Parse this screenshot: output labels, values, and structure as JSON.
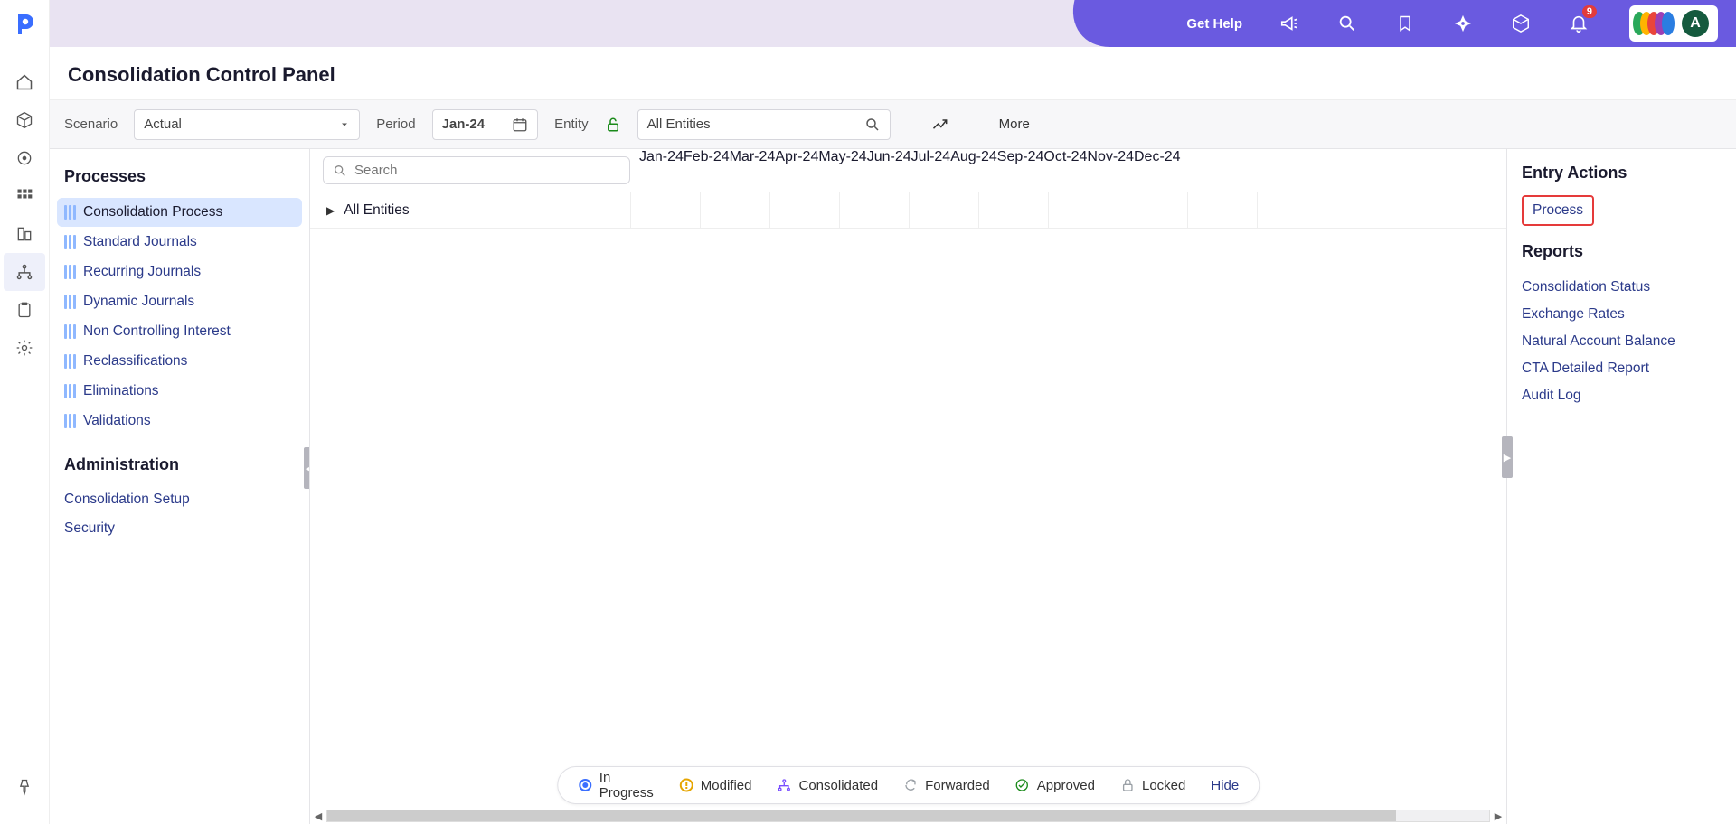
{
  "topbar": {
    "get_help": "Get Help",
    "notif_count": "9",
    "avatar_initial": "A"
  },
  "page_title": "Consolidation Control Panel",
  "filters": {
    "scenario_label": "Scenario",
    "scenario_value": "Actual",
    "period_label": "Period",
    "period_value": "Jan-24",
    "entity_label": "Entity",
    "entity_value": "All Entities",
    "more": "More"
  },
  "left": {
    "processes_header": "Processes",
    "items": [
      "Consolidation Process",
      "Standard Journals",
      "Recurring Journals",
      "Dynamic Journals",
      "Non Controlling Interest",
      "Reclassifications",
      "Eliminations",
      "Validations"
    ],
    "admin_header": "Administration",
    "admin_items": [
      "Consolidation Setup",
      "Security"
    ]
  },
  "center": {
    "search_placeholder": "Search",
    "months": [
      "Jan-24",
      "Feb-24",
      "Mar-24",
      "Apr-24",
      "May-24",
      "Jun-24",
      "Jul-24",
      "Aug-24",
      "Sep-24",
      "Oct-24",
      "Nov-24",
      "Dec-24"
    ],
    "tree_root": "All Entities"
  },
  "legend": {
    "in_progress": "In Progress",
    "modified": "Modified",
    "consolidated": "Consolidated",
    "forwarded": "Forwarded",
    "approved": "Approved",
    "locked": "Locked",
    "hide": "Hide"
  },
  "right": {
    "entry_actions_header": "Entry Actions",
    "process": "Process",
    "reports_header": "Reports",
    "reports": [
      "Consolidation Status",
      "Exchange Rates",
      "Natural Account Balance",
      "CTA Detailed Report",
      "Audit Log"
    ]
  }
}
